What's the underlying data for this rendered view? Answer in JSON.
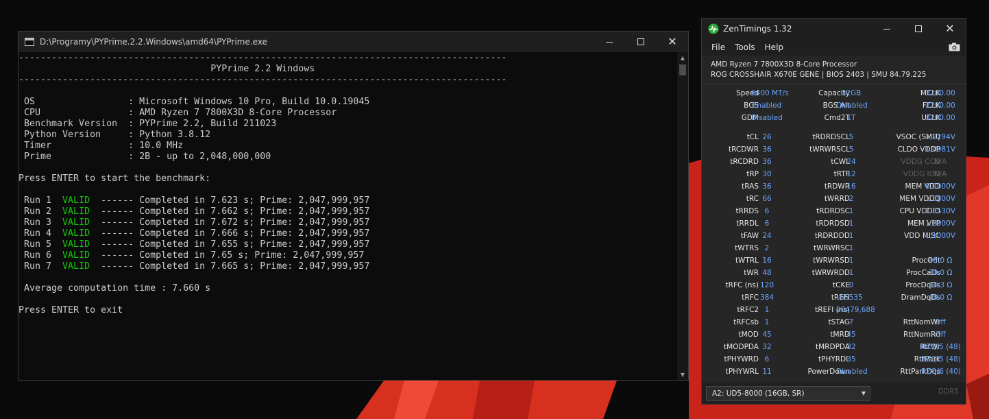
{
  "console": {
    "title": "D:\\Programy\\PYPrime.2.2.Windows\\amd64\\PYPrime.exe",
    "lines": [
      {
        "text": "-----------------------------------------------------------------------------------------"
      },
      {
        "text": "                                   PYPrime 2.2 Windows"
      },
      {
        "text": "-----------------------------------------------------------------------------------------"
      },
      {
        "text": ""
      },
      {
        "text": " OS                 : Microsoft Windows 10 Pro, Build 10.0.19045"
      },
      {
        "text": " CPU                : AMD Ryzen 7 7800X3D 8-Core Processor"
      },
      {
        "text": " Benchmark Version  : PYPrime 2.2, Build 211023"
      },
      {
        "text": " Python Version     : Python 3.8.12"
      },
      {
        "text": " Timer              : 10.0 MHz"
      },
      {
        "text": " Prime              : 2B - up to 2,048,000,000"
      },
      {
        "text": ""
      },
      {
        "text": "Press ENTER to start the benchmark:"
      },
      {
        "text": ""
      },
      {
        "run": " Run 1  ",
        "status": "VALID",
        "rest": "  ------ Completed in 7.623 s; Prime: 2,047,999,957"
      },
      {
        "run": " Run 2  ",
        "status": "VALID",
        "rest": "  ------ Completed in 7.662 s; Prime: 2,047,999,957"
      },
      {
        "run": " Run 3  ",
        "status": "VALID",
        "rest": "  ------ Completed in 7.672 s; Prime: 2,047,999,957"
      },
      {
        "run": " Run 4  ",
        "status": "VALID",
        "rest": "  ------ Completed in 7.666 s; Prime: 2,047,999,957"
      },
      {
        "run": " Run 5  ",
        "status": "VALID",
        "rest": "  ------ Completed in 7.655 s; Prime: 2,047,999,957"
      },
      {
        "run": " Run 6  ",
        "status": "VALID",
        "rest": "  ------ Completed in 7.65 s; Prime: 2,047,999,957"
      },
      {
        "run": " Run 7  ",
        "status": "VALID",
        "rest": "  ------ Completed in 7.665 s; Prime: 2,047,999,957"
      },
      {
        "text": ""
      },
      {
        "text": " Average computation time : 7.660 s"
      },
      {
        "text": ""
      },
      {
        "text": "Press ENTER to exit"
      }
    ]
  },
  "zen": {
    "title": "ZenTimings 1.32",
    "menu": [
      "File",
      "Tools",
      "Help"
    ],
    "cpu": "AMD Ryzen 7 7800X3D 8-Core Processor",
    "board": "ROG CROSSHAIR X670E GENE | BIOS 2403 | SMU 84.79.225",
    "rows": [
      [
        [
          "Speed",
          "6400 MT/s"
        ],
        [
          "Capacity",
          "32GB"
        ],
        [
          "MCLK",
          "3200.00"
        ]
      ],
      [
        [
          "BGS",
          "Enabled"
        ],
        [
          "BGS Alt",
          "Disabled"
        ],
        [
          "FCLK",
          "2200.00"
        ]
      ],
      [
        [
          "GDM",
          "Disabled"
        ],
        [
          "Cmd2T",
          "1T"
        ],
        [
          "UCLK",
          "3200.00"
        ]
      ],
      null,
      [
        [
          "tCL",
          "26"
        ],
        [
          "tRDRDSCL",
          "5"
        ],
        [
          "VSOC (SMU)",
          "1,2294V"
        ]
      ],
      [
        [
          "tRCDWR",
          "36"
        ],
        [
          "tWRWRSCL",
          "5"
        ],
        [
          "CLDO VDDP",
          "1,0981V"
        ]
      ],
      [
        [
          "tRCDRD",
          "36"
        ],
        [
          "tCWL",
          "24"
        ],
        [
          "VDDG CCD",
          "N/A",
          "dim"
        ]
      ],
      [
        [
          "tRP",
          "30"
        ],
        [
          "tRTP",
          "12"
        ],
        [
          "VDDG IOD",
          "N/A",
          "dim"
        ]
      ],
      [
        [
          "tRAS",
          "36"
        ],
        [
          "tRDWR",
          "16"
        ],
        [
          "MEM VDD",
          "0.0000V"
        ]
      ],
      [
        [
          "tRC",
          "66"
        ],
        [
          "tWRRD",
          "2"
        ],
        [
          "MEM VDDQ",
          "1.3800V"
        ]
      ],
      [
        [
          "tRRDS",
          "6"
        ],
        [
          "tRDRDSC",
          "1"
        ],
        [
          "CPU VDDIO",
          "1.3530V"
        ]
      ],
      [
        [
          "tRRDL",
          "6"
        ],
        [
          "tRDRDSD",
          "1"
        ],
        [
          "MEM VPP",
          "1.8000V"
        ]
      ],
      [
        [
          "tFAW",
          "24"
        ],
        [
          "tRDRDDD",
          "1"
        ],
        [
          "VDD MISC",
          "1,1000V"
        ]
      ],
      [
        [
          "tWTRS",
          "2"
        ],
        [
          "tWRWRSC",
          "1"
        ],
        null
      ],
      [
        [
          "tWTRL",
          "16"
        ],
        [
          "tWRWRSD",
          "1"
        ],
        [
          "ProcOdt",
          "48.0 Ω"
        ]
      ],
      [
        [
          "tWR",
          "48"
        ],
        [
          "tWRWRDD",
          "1"
        ],
        [
          "ProcCaDs",
          "30.0 Ω"
        ]
      ],
      [
        [
          "tRFC (ns)",
          "120"
        ],
        [
          "tCKE",
          "0"
        ],
        [
          "ProcDqDs",
          "34.3 Ω"
        ]
      ],
      [
        [
          "tRFC",
          "384"
        ],
        [
          "tREFI",
          "65535"
        ],
        [
          "DramDqDs",
          "48.0 Ω"
        ]
      ],
      [
        [
          "tRFC2",
          "1"
        ],
        [
          "tREFI (ns)",
          "20479,688"
        ],
        null
      ],
      [
        [
          "tRFCsb",
          "1"
        ],
        [
          "tSTAG",
          "7"
        ],
        [
          "RttNomWr",
          "Off"
        ]
      ],
      [
        [
          "tMOD",
          "45"
        ],
        [
          "tMRD",
          "45"
        ],
        [
          "RttNomRd",
          "Off"
        ]
      ],
      [
        [
          "tMODPDA",
          "32"
        ],
        [
          "tMRDPDA",
          "32"
        ],
        [
          "RttWr",
          "RZQ/5 (48)"
        ]
      ],
      [
        [
          "tPHYWRD",
          "6"
        ],
        [
          "tPHYRDL",
          "35"
        ],
        [
          "RttPark",
          "RZQ/5 (48)"
        ]
      ],
      [
        [
          "tPHYWRL",
          "11"
        ],
        [
          "PowerDown",
          "Disabled"
        ],
        [
          "RttParkDqs",
          "RZQ/6 (40)"
        ]
      ]
    ],
    "dimm": "A2: UD5-8000 (16GB, SR)",
    "ddr": "DDR5"
  },
  "colors": {
    "accent": "#6aa6ff",
    "valid": "#16c60c",
    "desktop_red": "#d42a1c"
  }
}
